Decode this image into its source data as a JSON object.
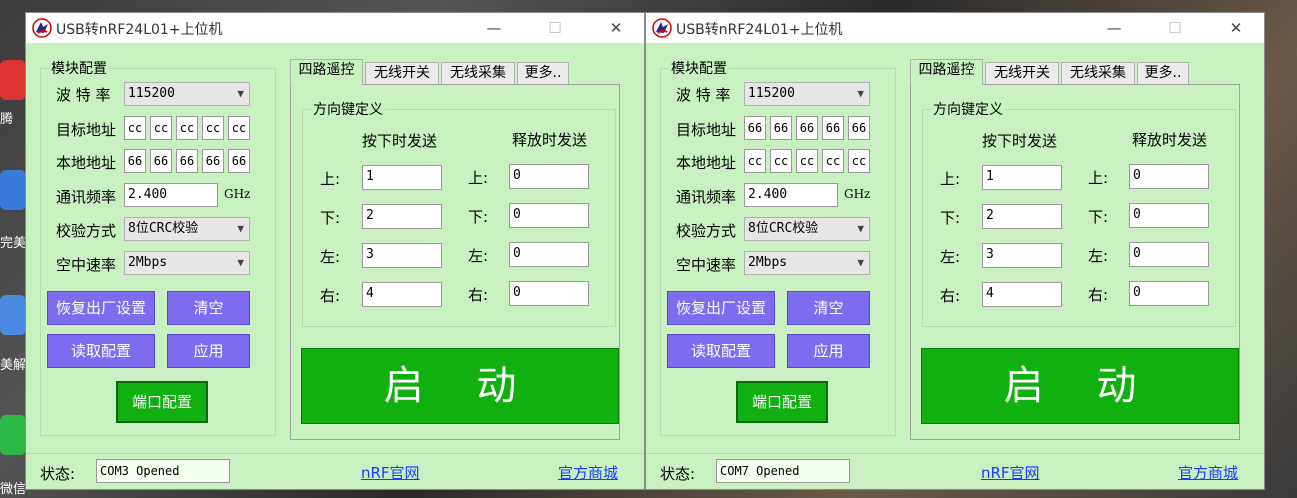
{
  "desktop": {
    "labels": [
      "腾",
      "完美",
      "美解",
      "微信"
    ]
  },
  "windows": [
    {
      "title": "USB转nRF24L01+上位机",
      "controls": {
        "minimize": "—",
        "maximize": "☐",
        "close": "✕"
      },
      "module_config": {
        "title": "模块配置",
        "baud_label": "波 特 率",
        "baud_value": "115200",
        "target_label": "目标地址",
        "target_bytes": [
          "cc",
          "cc",
          "cc",
          "cc",
          "cc"
        ],
        "local_label": "本地地址",
        "local_bytes": [
          "66",
          "66",
          "66",
          "66",
          "66"
        ],
        "freq_label": "通讯频率",
        "freq_value": "2.400",
        "freq_unit": "GHz",
        "crc_label": "校验方式",
        "crc_value": "8位CRC校验",
        "rate_label": "空中速率",
        "rate_value": "2Mbps",
        "btn_reset": "恢复出厂设置",
        "btn_clear": "清空",
        "btn_read": "读取配置",
        "btn_apply": "应用",
        "btn_port": "端口配置"
      },
      "tabs": [
        "四路遥控",
        "无线开关",
        "无线采集",
        "更多.."
      ],
      "direction": {
        "title": "方向键定义",
        "press_header": "按下时发送",
        "release_header": "释放时发送",
        "rows": [
          {
            "label": "上:",
            "press": "1",
            "release": "0"
          },
          {
            "label": "下:",
            "press": "2",
            "release": "0"
          },
          {
            "label": "左:",
            "press": "3",
            "release": "0"
          },
          {
            "label": "右:",
            "press": "4",
            "release": "0"
          }
        ]
      },
      "start_label": "启 动",
      "status": {
        "label": "状态:",
        "value": "COM3 Opened",
        "link1": "nRF官网",
        "link2": "官方商城"
      }
    },
    {
      "title": "USB转nRF24L01+上位机",
      "controls": {
        "minimize": "—",
        "maximize": "☐",
        "close": "✕"
      },
      "module_config": {
        "title": "模块配置",
        "baud_label": "波 特 率",
        "baud_value": "115200",
        "target_label": "目标地址",
        "target_bytes": [
          "66",
          "66",
          "66",
          "66",
          "66"
        ],
        "local_label": "本地地址",
        "local_bytes": [
          "cc",
          "cc",
          "cc",
          "cc",
          "cc"
        ],
        "freq_label": "通讯频率",
        "freq_value": "2.400",
        "freq_unit": "GHz",
        "crc_label": "校验方式",
        "crc_value": "8位CRC校验",
        "rate_label": "空中速率",
        "rate_value": "2Mbps",
        "btn_reset": "恢复出厂设置",
        "btn_clear": "清空",
        "btn_read": "读取配置",
        "btn_apply": "应用",
        "btn_port": "端口配置"
      },
      "tabs": [
        "四路遥控",
        "无线开关",
        "无线采集",
        "更多.."
      ],
      "direction": {
        "title": "方向键定义",
        "press_header": "按下时发送",
        "release_header": "释放时发送",
        "rows": [
          {
            "label": "上:",
            "press": "1",
            "release": "0"
          },
          {
            "label": "下:",
            "press": "2",
            "release": "0"
          },
          {
            "label": "左:",
            "press": "3",
            "release": "0"
          },
          {
            "label": "右:",
            "press": "4",
            "release": "0"
          }
        ]
      },
      "start_label": "启 动",
      "status": {
        "label": "状态:",
        "value": "COM7 Opened",
        "link1": "nRF官网",
        "link2": "官方商城"
      }
    }
  ],
  "colors": {
    "window_bg": "#c8f0c0",
    "purple_button": "#7d6bf0",
    "green_button": "#10b010",
    "link": "#1a3cff"
  }
}
